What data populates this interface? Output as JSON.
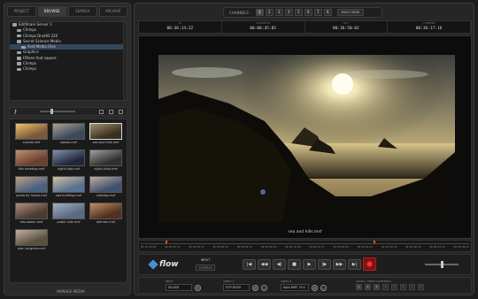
{
  "tabs": [
    {
      "label": "PROJECT",
      "active": false
    },
    {
      "label": "BROWSE",
      "active": true
    },
    {
      "label": "SEARCH",
      "active": false
    },
    {
      "label": "ARCHIVE",
      "active": false
    }
  ],
  "tree": [
    {
      "label": "EditShare Server 1",
      "indent": 0,
      "selected": false
    },
    {
      "label": "Chimps",
      "indent": 1,
      "selected": false
    },
    {
      "label": "Chimps DnxHD 220",
      "indent": 1,
      "selected": false
    },
    {
      "label": "Secret Science Media",
      "indent": 1,
      "selected": false
    },
    {
      "label": "Avid Media Files",
      "indent": 2,
      "selected": true
    },
    {
      "label": "Graphics",
      "indent": 1,
      "selected": false
    },
    {
      "label": "Fifteen foot square",
      "indent": 1,
      "selected": false
    },
    {
      "label": "Chimps",
      "indent": 1,
      "selected": false
    },
    {
      "label": "Chimps",
      "indent": 1,
      "selected": false
    }
  ],
  "thumbnails": [
    {
      "name": "sunset.mxf",
      "c1": "#7a5a3a",
      "c2": "#f0c070",
      "selected": false
    },
    {
      "name": "waves.mxf",
      "c1": "#3a4a5a",
      "c2": "#b0a090",
      "selected": false
    },
    {
      "name": "sea and hills.mxf",
      "c1": "#3a3020",
      "c2": "#a09070",
      "selected": true
    },
    {
      "name": "fish meeting.mxf",
      "c1": "#6a4030",
      "c2": "#c09070",
      "selected": false
    },
    {
      "name": "night sida.mxf",
      "c1": "#202838",
      "c2": "#8090b0",
      "selected": false
    },
    {
      "name": "night chita.mxf",
      "c1": "#303030",
      "c2": "#a0a0a0",
      "selected": false
    },
    {
      "name": "sylvia by house.mxf",
      "c1": "#4a6080",
      "c2": "#c0a080",
      "selected": false
    },
    {
      "name": "spa building.mxf",
      "c1": "#5a7090",
      "c2": "#d0c0a0",
      "selected": false
    },
    {
      "name": "chatday.mxf",
      "c1": "#405070",
      "c2": "#c0b0a0",
      "selected": false
    },
    {
      "name": "discussion.mxf",
      "c1": "#4a3a30",
      "c2": "#b09080",
      "selected": false
    },
    {
      "name": "public talk.mxf",
      "c1": "#5a6a80",
      "c2": "#a0b0c0",
      "selected": false
    },
    {
      "name": "dolman.mxf",
      "c1": "#503020",
      "c2": "#c09060",
      "selected": false
    },
    {
      "name": "alan mcguire.mxf",
      "c1": "#5a5040",
      "c2": "#c0b0a0",
      "selected": false
    }
  ],
  "manage_label": "MANAGE MEDIA",
  "channels": {
    "label": "CHANNELS",
    "buttons": [
      "1",
      "2",
      "3",
      "4",
      "5",
      "6",
      "7",
      "8"
    ],
    "active": "1",
    "multiview": "MULTI VIEW"
  },
  "timecodes": [
    {
      "title": "TC",
      "value": "00:36:14:22"
    },
    {
      "title": "DURATION",
      "value": "00:00:45:05"
    },
    {
      "title": "OUT",
      "value": "00:36:50:02"
    },
    {
      "title": "CURRENT",
      "value": "00:36:17:16"
    }
  ],
  "clip_name": "sea and hills.mxf",
  "timeline_ticks": [
    "00:35:45:05",
    "00:35:50:11",
    "00:35:54:21",
    "00:36:00:05",
    "00:36:04:15",
    "00:36:09:23",
    "00:36:15:09",
    "00:36:19:17",
    "00:36:25:01",
    "00:36:29:11",
    "00:36:34:19",
    "00:36:40:05",
    "00:36:44:13",
    "00:36:49:21"
  ],
  "brand": "flow",
  "input_label": "INPUT",
  "output_label": "OUTPUT",
  "transport": [
    "|◀",
    "◀◀",
    "◀|",
    "■",
    "▶",
    "|▶",
    "▶▶",
    "▶|"
  ],
  "bottom": {
    "input": {
      "title": "INPUT",
      "value": "SD-SDI"
    },
    "video": {
      "title": "VIDEO 1",
      "value": "FCP DV25"
    },
    "video2": {
      "title": "VIDEO 2",
      "value": "Avid MXF 15:1"
    },
    "audio": {
      "title": "AUDIO / VIDEO CONTROLS",
      "channels": [
        "1",
        "2",
        "3",
        "4",
        "5",
        "6",
        "7",
        "8"
      ],
      "active": [
        "1",
        "2",
        "3"
      ]
    }
  }
}
